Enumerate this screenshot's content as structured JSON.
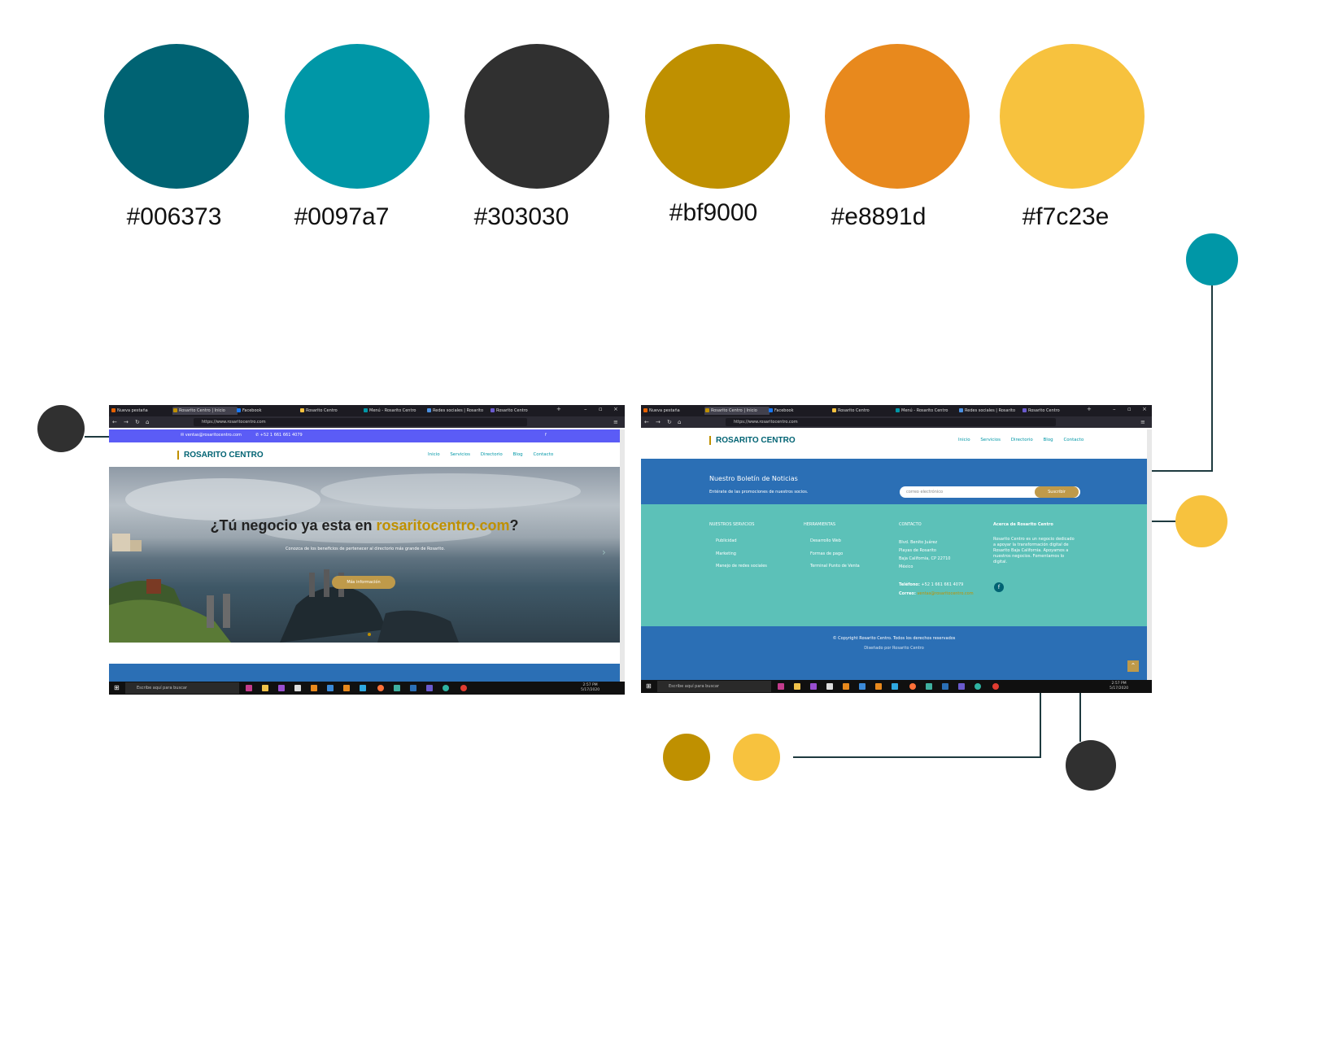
{
  "palette": [
    {
      "hex": "#006373",
      "label": "#006373"
    },
    {
      "hex": "#0097a7",
      "label": "#0097a7"
    },
    {
      "hex": "#303030",
      "label": "#303030"
    },
    {
      "hex": "#bf9000",
      "label": "#bf9000"
    },
    {
      "hex": "#e8891d",
      "label": "#e8891d"
    },
    {
      "hex": "#f7c23e",
      "label": "#f7c23e"
    }
  ],
  "browser": {
    "tabs": [
      "Nueva pestaña",
      "Rosarito Centro | Inicio",
      "Facebook",
      "Rosarito Centro",
      "Menú - Rosarito Centro",
      "Redes sociales | Rosarito",
      "Rosarito Centro"
    ],
    "url_left": "https://www.rosaritocentro.com",
    "url_right": "https://www.rosaritocentro.com"
  },
  "left_site": {
    "topbar_email": "ventas@rosaritocentro.com",
    "topbar_phone": "+52 1 661 661 4079",
    "brand": "ROSARITO CENTRO",
    "nav": [
      "Inicio",
      "Servicios",
      "Directorio",
      "Blog",
      "Contacto"
    ],
    "hero_title_pre": "¿Tú negocio ya esta en ",
    "hero_title_highlight": "rosaritocentro.com",
    "hero_title_post": "?",
    "hero_text": "Conozca de los beneficios de pertenecer al directorio más grande de Rosarito.",
    "hero_button": "Más información"
  },
  "right_site": {
    "brand": "ROSARITO CENTRO",
    "nav": [
      "Inicio",
      "Servicios",
      "Directorio",
      "Blog",
      "Contacto"
    ],
    "newsletter_title": "Nuestro Boletín de Noticias",
    "newsletter_text": "Entérate de las promociones de nuestros socios.",
    "newsletter_placeholder": "correo electrónico",
    "newsletter_button": "Suscribir",
    "col_services_title": "NUESTROS SERVICIOS",
    "col_services": [
      "Publicidad",
      "Marketing",
      "Manejo de redes sociales"
    ],
    "col_tools_title": "HERRAMIENTAS",
    "col_tools": [
      "Desarrollo Web",
      "Formas de pago",
      "Terminal Punto de Venta"
    ],
    "col_contact_title": "CONTACTO",
    "col_contact": [
      "Blvd. Benito Juárez",
      "Playas de Rosarito",
      "Baja California, CP 22710",
      "México"
    ],
    "contact_phone_label": "Teléfono:",
    "contact_phone": "+52 1 661 661 4079",
    "contact_email_label": "Correo:",
    "contact_email": "ventas@rosaritocentro.com",
    "col_about_title": "Acerca de Rosarito Centro",
    "col_about_text": "Rosarito Centro es un negocio dedicado a apoyar la transformación digital de Rosarito Baja California. Apoyamos a nuestros negocios. Fomentamos lo digital.",
    "copyright": "© Copyright Rosarito Centro. Todos los derechos reservados",
    "designed_by": "Diseñado por Rosarito Centro"
  },
  "taskbar": {
    "search_left": "Escribe aquí para buscar",
    "search_right": "Escribe aquí para buscar",
    "time": "2:57 PM",
    "date": "5/17/2020"
  }
}
